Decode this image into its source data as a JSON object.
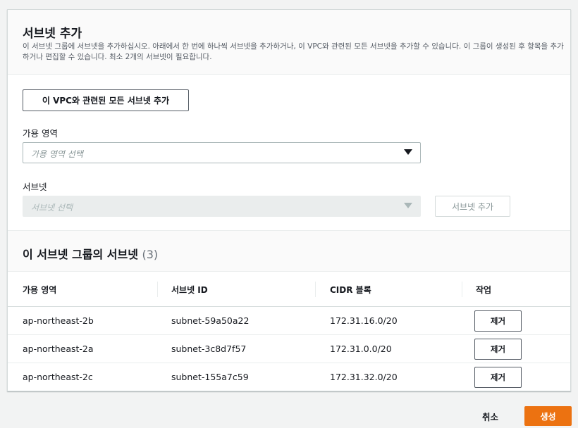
{
  "panel": {
    "title": "서브넷 추가",
    "description": "이 서브넷 그룹에 서브넷을 추가하십시오. 아래에서 한 번에 하나씩 서브넷을 추가하거나, 이 VPC와 관련된 모든 서브넷을 추가할 수 있습니다. 이 그룹이 생성된 후 항목을 추가하거나 편집할 수 있습니다. 최소 2개의 서브넷이 필요합니다.",
    "add_all_label": "이 VPC와 관련된 모든 서브넷 추가"
  },
  "az_field": {
    "label": "가용 영역",
    "placeholder": "가용 영역 선택"
  },
  "subnet_field": {
    "label": "서브넷",
    "placeholder": "서브넷 선택",
    "add_label": "서브넷 추가"
  },
  "subnets_section": {
    "title": "이 서브넷 그룹의 서브넷",
    "count": "(3)"
  },
  "table": {
    "headers": [
      "가용 영역",
      "서브넷 ID",
      "CIDR 블록",
      "작업"
    ],
    "rows": [
      {
        "az": "ap-northeast-2b",
        "subnet_id": "subnet-59a50a22",
        "cidr": "172.31.16.0/20",
        "action": "제거"
      },
      {
        "az": "ap-northeast-2a",
        "subnet_id": "subnet-3c8d7f57",
        "cidr": "172.31.0.0/20",
        "action": "제거"
      },
      {
        "az": "ap-northeast-2c",
        "subnet_id": "subnet-155a7c59",
        "cidr": "172.31.32.0/20",
        "action": "제거"
      }
    ]
  },
  "footer": {
    "cancel_label": "취소",
    "create_label": "생성"
  },
  "colors": {
    "primary": "#ec7211",
    "border": "#d5dbdb"
  }
}
